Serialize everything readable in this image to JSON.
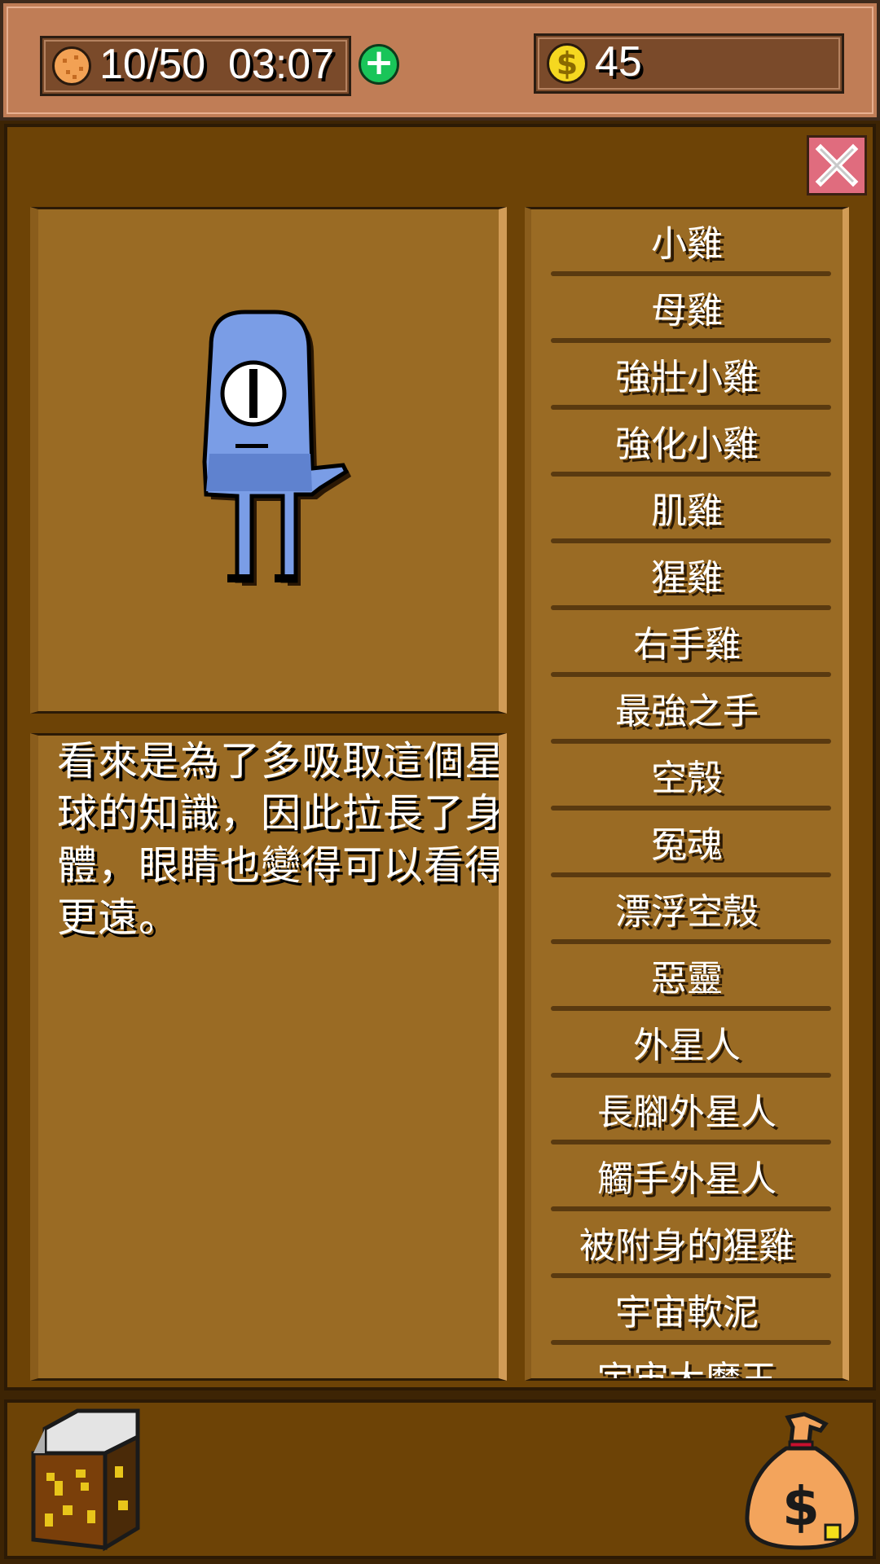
{
  "hud": {
    "food_count": "10/50",
    "timer": "03:07",
    "coins": "45",
    "food_icon": "cookie-icon",
    "coin_icon": "dollar-coin-icon",
    "add_icon": "plus-icon"
  },
  "close_icon": "close-icon",
  "creature": {
    "description": "看來是為了多吸取這個星球的知識，因此拉長了身體，眼睛也變得可以看得更遠。"
  },
  "collection": [
    {
      "label": "小雞"
    },
    {
      "label": "母雞"
    },
    {
      "label": "強壯小雞"
    },
    {
      "label": "強化小雞"
    },
    {
      "label": "肌雞"
    },
    {
      "label": "猩雞"
    },
    {
      "label": "右手雞"
    },
    {
      "label": "最強之手"
    },
    {
      "label": "空殼"
    },
    {
      "label": "冤魂"
    },
    {
      "label": "漂浮空殼"
    },
    {
      "label": "惡靈"
    },
    {
      "label": "外星人"
    },
    {
      "label": "長腳外星人"
    },
    {
      "label": "觸手外星人"
    },
    {
      "label": "被附身的猩雞"
    },
    {
      "label": "宇宙軟泥"
    },
    {
      "label": "宇宙大魔王"
    }
  ],
  "bottom": {
    "left_icon": "encyclopedia-book-icon",
    "right_icon": "money-bag-icon"
  },
  "colors": {
    "panel": "#6d4306",
    "card": "#9a6b24",
    "topbar": "#c07d56",
    "creature_blue": "#7a9de6",
    "close_red": "#e06c7e",
    "add_green": "#19c559",
    "coin_yellow": "#f5d820"
  }
}
